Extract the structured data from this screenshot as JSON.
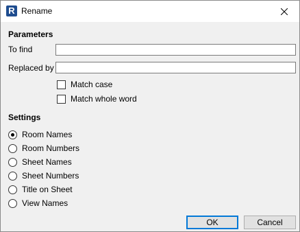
{
  "window": {
    "title": "Rename",
    "app_icon_letter": "R"
  },
  "parameters": {
    "heading": "Parameters",
    "to_find_label": "To find",
    "to_find_value": "",
    "replaced_by_label": "Replaced by",
    "replaced_by_value": "",
    "match_case_label": "Match case",
    "match_case_checked": false,
    "match_whole_word_label": "Match whole word",
    "match_whole_word_checked": false
  },
  "settings": {
    "heading": "Settings",
    "options": [
      {
        "label": "Room Names",
        "selected": true
      },
      {
        "label": "Room Numbers",
        "selected": false
      },
      {
        "label": "Sheet Names",
        "selected": false
      },
      {
        "label": "Sheet Numbers",
        "selected": false
      },
      {
        "label": "Title on Sheet",
        "selected": false
      },
      {
        "label": "View Names",
        "selected": false
      }
    ]
  },
  "buttons": {
    "ok_label": "OK",
    "cancel_label": "Cancel"
  },
  "colors": {
    "accent": "#0078d7",
    "app_icon": "#1f4d8f"
  }
}
